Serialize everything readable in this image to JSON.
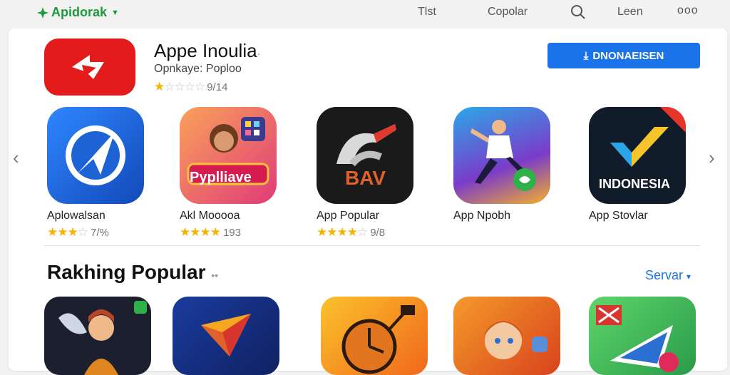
{
  "topbar": {
    "brand": "Apidorak",
    "links": [
      "Tlst",
      "Copolar",
      "Leen"
    ],
    "more": "ooo"
  },
  "featured": {
    "title": "Appe Inoulia",
    "subtitle": "Opnkaye: Poploo",
    "rating_text": "9/14",
    "rating_stars": 1,
    "install_label": "DNONAEISEN"
  },
  "carousel": [
    {
      "name": "Aplowalsan",
      "rating": "7/%",
      "stars": 3.5,
      "icon": "paper-plane-icon",
      "color": "#1e63d6"
    },
    {
      "name": "Akl Mooooa",
      "rating": "193",
      "stars": 4,
      "icon": "woman-popular-icon",
      "color": "#e04f7c",
      "caption": "Pyplliave"
    },
    {
      "name": "App Popular",
      "rating": "9/8",
      "stars": 3.5,
      "icon": "brush-bav-icon",
      "color": "#1a1a1a",
      "caption": "BAV"
    },
    {
      "name": "App Npobh",
      "rating": "",
      "stars": 0,
      "icon": "dancer-chat-icon",
      "color": "#2d6fd8"
    },
    {
      "name": "App Stovlar",
      "rating": "",
      "stars": 0,
      "icon": "indonesia-check-icon",
      "color": "#111c2b",
      "caption": "INDONESIA"
    }
  ],
  "section": {
    "title": "Rakhing Popular",
    "see_all": "Servar"
  },
  "ranked": [
    {
      "icon": "angel-character-icon",
      "color": "#1b1f2e"
    },
    {
      "icon": "origami-plane-icon",
      "color": "#16307a"
    },
    {
      "icon": "clock-icon",
      "color": "#f18a1c"
    },
    {
      "icon": "girl-character-icon",
      "color": "#e4561e"
    },
    {
      "icon": "triangle-play-icon",
      "color": "#2fae5a"
    }
  ]
}
